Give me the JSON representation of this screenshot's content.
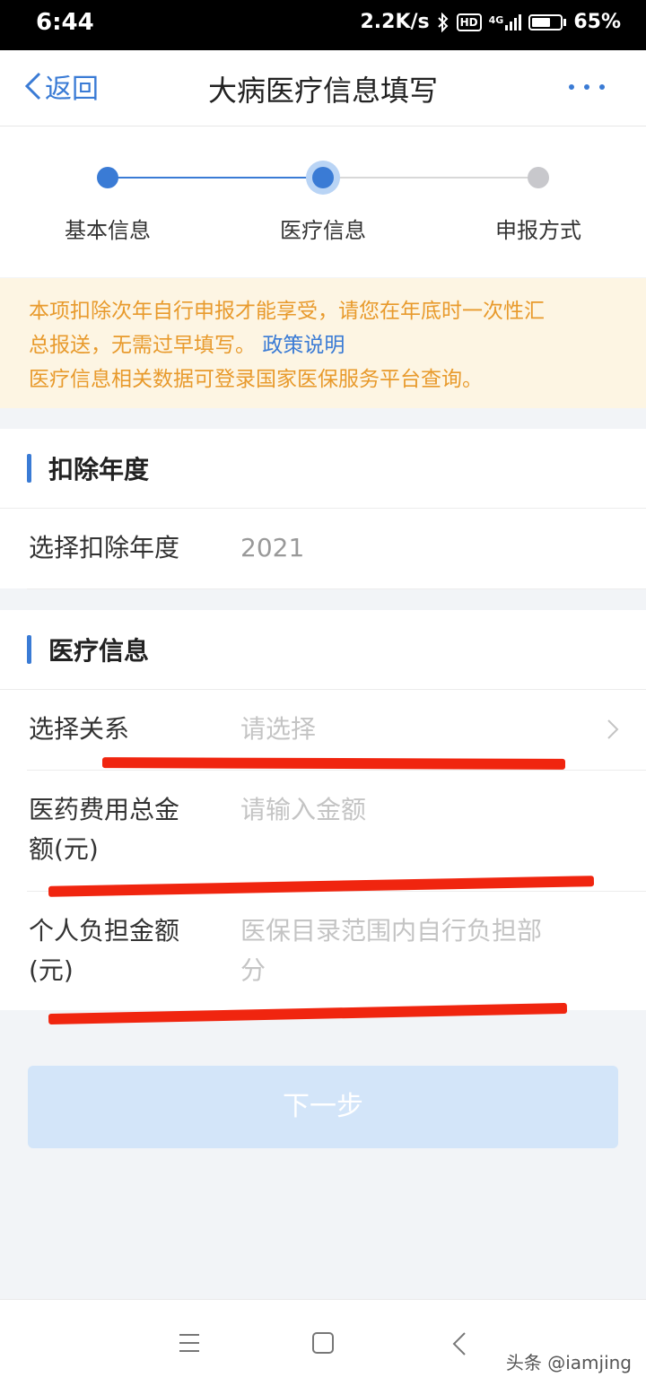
{
  "status_bar": {
    "time": "6:44",
    "net_speed": "2.2K/s",
    "hd": "HD",
    "signal": "4G",
    "battery_percent": "65%",
    "battery_level": 0.65
  },
  "nav": {
    "back_label": "返回",
    "title": "大病医疗信息填写"
  },
  "steps": [
    {
      "label": "基本信息",
      "state": "done"
    },
    {
      "label": "医疗信息",
      "state": "current"
    },
    {
      "label": "申报方式",
      "state": "pending"
    }
  ],
  "notice": {
    "line1": "本项扣除次年自行申报才能享受，请您在年底时一次性汇",
    "line2": "总报送，无需过早填写。",
    "link": "政策说明",
    "line3": "医疗信息相关数据可登录国家医保服务平台查询。"
  },
  "deduction_section": {
    "title": "扣除年度",
    "year_label": "选择扣除年度",
    "year_value": "2021"
  },
  "medical_section": {
    "title": "医疗信息",
    "relation_label": "选择关系",
    "relation_placeholder": "请选择",
    "total_label_1": "医药费用总金",
    "total_label_2": "额(元)",
    "total_placeholder": "请输入金额",
    "personal_label_1": "个人负担金额",
    "personal_label_2": "(元)",
    "personal_placeholder_1": "医保目录范围内自行负担部",
    "personal_placeholder_2": "分"
  },
  "next_button": "下一步",
  "watermark": "头条 @iamjing",
  "colors": {
    "accent": "#3a7bd5",
    "notice_text": "#e89a2c",
    "notice_bg": "#fdf5e3",
    "annotation_red": "#f0250f",
    "button_disabled": "#d3e5f9"
  }
}
